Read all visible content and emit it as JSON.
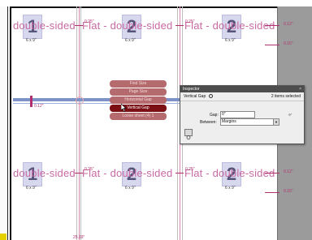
{
  "colors": {
    "accent": "#c96aa3",
    "guide_pink": "#d98ab4",
    "menu_active": "#7b0f14",
    "menu_inactive": "#b56a6e",
    "gutter": "#9b9b9b"
  },
  "pages": {
    "row1": [
      {
        "number": "1",
        "size": "6 x 9\""
      },
      {
        "number": "2",
        "size": "6 x 9\""
      },
      {
        "number": "2",
        "size": "6 x 9\""
      }
    ],
    "row2": [
      {
        "number": "1",
        "size": "6 x 9\""
      },
      {
        "number": "2",
        "size": "6 x 9\""
      },
      {
        "number": "2",
        "size": "6 x 9\""
      }
    ],
    "masters_row1": [
      "double-sided",
      "Flat - double-sided",
      "Flat - double-sided"
    ],
    "masters_row2": [
      "double-sided",
      "Flat - double-sided",
      "Flat - double-sided"
    ]
  },
  "dimensions": {
    "row1_gap_a": "0.25\"",
    "row1_gap_b": "0.25\"",
    "row1_right_top": "0.12\"",
    "row1_right_mid": "0.15\"",
    "row2_gap_a": "0.25\"",
    "row2_gap_b": "0.25\"",
    "row2_right_top": "0.12\"",
    "row2_right_mid": "0.15\"",
    "left_indent": "0.12\"",
    "bottom": "25.19\""
  },
  "context_menu": {
    "items": [
      "Find Size",
      "Page Size",
      "Horizontal Gap",
      "Vertical Gap",
      "Loose sheet (4) 1"
    ],
    "active_index": 3
  },
  "inspector": {
    "title": "Inspector",
    "close_glyph": "×",
    "section": "Vertical Gap",
    "selection_status": "2 items selected",
    "gap_label": "Gap:",
    "gap_value": "0\"",
    "between_label": "Between:",
    "between_value": "Margins"
  }
}
